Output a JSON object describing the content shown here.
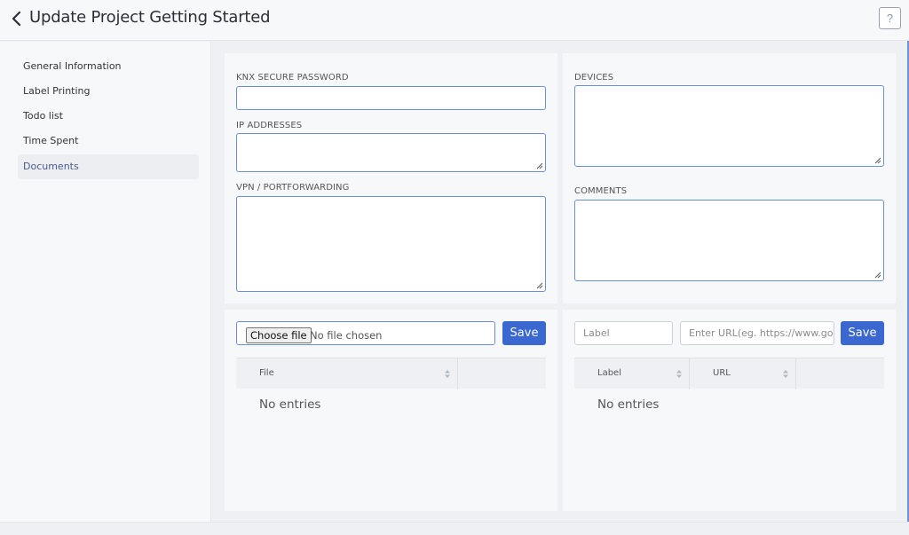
{
  "header": {
    "title": "Update Project Getting Started",
    "help_label": "?"
  },
  "sidebar": {
    "items": [
      {
        "label": "General Information"
      },
      {
        "label": "Label Printing"
      },
      {
        "label": "Todo list"
      },
      {
        "label": "Time Spent"
      },
      {
        "label": "Documents"
      }
    ],
    "active_index": 4
  },
  "form_left": {
    "knx_label": "KNX SECURE PASSWORD",
    "knx_value": "",
    "ip_label": "IP ADDRESSES",
    "ip_value": "",
    "vpn_label": "VPN / PORTFORWARDING",
    "vpn_value": ""
  },
  "form_right": {
    "devices_label": "DEVICES",
    "devices_value": "",
    "comments_label": "COMMENTS",
    "comments_value": ""
  },
  "files_panel": {
    "choose_label": "Choose file",
    "status": "No file chosen",
    "save_label": "Save",
    "columns": [
      "File",
      ""
    ],
    "empty_text": "No entries"
  },
  "links_panel": {
    "label_placeholder": "Label",
    "url_placeholder": "Enter URL(eg. https://www.google.com)",
    "save_label": "Save",
    "columns": [
      "Label",
      "URL",
      ""
    ],
    "empty_text": "No entries"
  },
  "colors": {
    "accent": "#3a68d0",
    "field_border": "#6b8fd6",
    "panel": "#f7f8fa"
  }
}
